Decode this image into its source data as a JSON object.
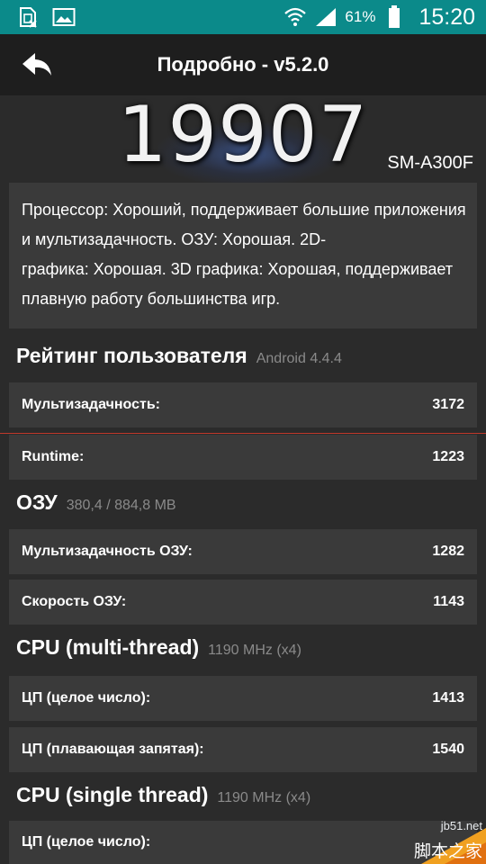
{
  "status_bar": {
    "battery_percent": "61%",
    "time": "15:20",
    "icons": [
      "sim-card-icon",
      "image-icon",
      "wifi-icon",
      "signal-icon",
      "battery-icon"
    ]
  },
  "app_bar": {
    "title": "Подробно - v5.2.0"
  },
  "score": {
    "value": "19907",
    "device_model": "SM-A300F"
  },
  "description": {
    "line1": "Процессор: Хороший, поддерживает большие приложения",
    "line2": "и мультизадачность. ОЗУ: Хорошая. 2D-",
    "line3": "графика: Хорошая. 3D графика: Хорошая, поддерживает",
    "line4": "плавную работу большинства игр."
  },
  "sections": {
    "user_rating": {
      "title": "Рейтинг пользователя",
      "sub": "Android 4.4.4",
      "rows": [
        {
          "label": "Мультизадачность:",
          "value": "3172"
        },
        {
          "label": "Runtime:",
          "value": "1223"
        }
      ]
    },
    "ram": {
      "title": "ОЗУ",
      "sub": "380,4 / 884,8 MB",
      "rows": [
        {
          "label": "Мультизадачность ОЗУ:",
          "value": "1282"
        },
        {
          "label": "Скорость ОЗУ:",
          "value": "1143"
        }
      ]
    },
    "cpu_multi": {
      "title": "CPU (multi-thread)",
      "sub": "1190 MHz (x4)",
      "rows": [
        {
          "label": "ЦП (целое число):",
          "value": "1413"
        },
        {
          "label": "ЦП (плавающая запятая):",
          "value": "1540"
        }
      ]
    },
    "cpu_single": {
      "title": "CPU (single thread)",
      "sub": "1190 MHz (x4)",
      "rows": [
        {
          "label": "ЦП (целое число):",
          "value": ""
        }
      ]
    }
  },
  "watermark": {
    "site": "jb51.net",
    "name": "脚本之家"
  },
  "colors": {
    "status_bar": "#0b8a8a",
    "app_bar": "#1e1e1e",
    "background": "#2b2b2b",
    "card": "#3a3a3a",
    "subtext": "#8a8a8a"
  }
}
